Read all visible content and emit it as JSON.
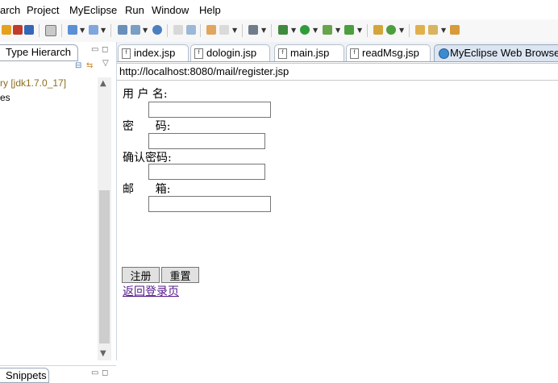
{
  "menubar": {
    "items": [
      "arch",
      "Project",
      "MyEclipse",
      "Run",
      "Window",
      "Help"
    ]
  },
  "left_panel": {
    "tab_label": "Type Hierarch",
    "tree_items": [
      "ry [jdk1.7.0_17]",
      "es"
    ],
    "snippets_label": "Snippets"
  },
  "editor_tabs": [
    {
      "label": "index.jsp",
      "active": false
    },
    {
      "label": "dologin.jsp",
      "active": false
    },
    {
      "label": "main.jsp",
      "active": false
    },
    {
      "label": "readMsg.jsp",
      "active": false
    },
    {
      "label": "MyEclipse Web Browse",
      "active": true
    }
  ],
  "browser": {
    "url": "http://localhost:8080/mail/register.jsp"
  },
  "form": {
    "username_label": "用 户 名:",
    "password_label": "密      码:",
    "confirm_label": "确认密码:",
    "email_label": "邮      箱:",
    "register_button": "注册",
    "reset_button": "重置",
    "back_link": "返回登录页"
  },
  "colors": {
    "link": "#551a8b",
    "tree_text": "#8a6d1d",
    "active_tab": "#dce6f2"
  }
}
